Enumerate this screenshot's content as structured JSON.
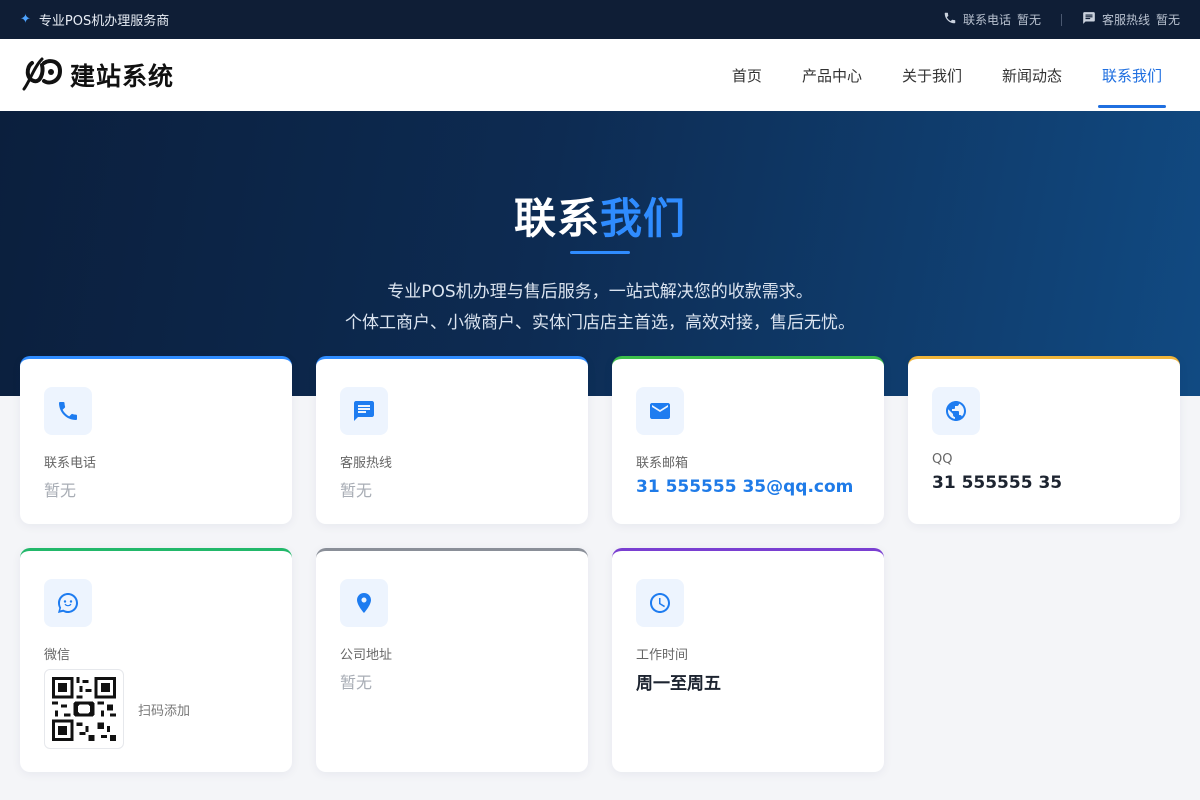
{
  "topbar": {
    "tagline": "专业POS机办理服务商",
    "phone_label": "联系电话",
    "phone_value": "暂无",
    "hotline_label": "客服热线",
    "hotline_value": "暂无"
  },
  "brand": {
    "name": "建站系统"
  },
  "nav": {
    "items": [
      {
        "label": "首页"
      },
      {
        "label": "产品中心"
      },
      {
        "label": "关于我们"
      },
      {
        "label": "新闻动态"
      },
      {
        "label": "联系我们",
        "active": true
      }
    ]
  },
  "hero": {
    "title_part1": "联系",
    "title_part2": "我们",
    "desc_line1": "专业POS机办理与售后服务，一站式解决您的收款需求。",
    "desc_line2": "个体工商户、小微商户、实体门店店主首选，高效对接，售后无忧。"
  },
  "cards": {
    "phone": {
      "label": "联系电话",
      "value": "暂无",
      "icon": "phone-icon",
      "accent": "#2f8cff"
    },
    "hotline": {
      "label": "客服热线",
      "value": "暂无",
      "icon": "chat-icon",
      "accent": "#2f8cff"
    },
    "email": {
      "label": "联系邮箱",
      "value": "31 555555 35@qq.com",
      "icon": "mail-icon",
      "accent": "#3cbf4a"
    },
    "qq": {
      "label": "QQ",
      "value": "31 555555 35",
      "icon": "globe-icon",
      "accent": "#f0b53a"
    },
    "wechat": {
      "label": "微信",
      "qr_caption": "扫码添加",
      "icon": "wechat-icon",
      "accent": "#22b86a"
    },
    "address": {
      "label": "公司地址",
      "value": "暂无",
      "icon": "location-icon",
      "accent": "#8a8f98"
    },
    "hours": {
      "label": "工作时间",
      "value": "周一至周五",
      "icon": "clock-icon",
      "accent": "#7a3fd1"
    }
  },
  "colors": {
    "brand_blue": "#1f6fe0",
    "topbar_bg": "#0f1e36"
  }
}
